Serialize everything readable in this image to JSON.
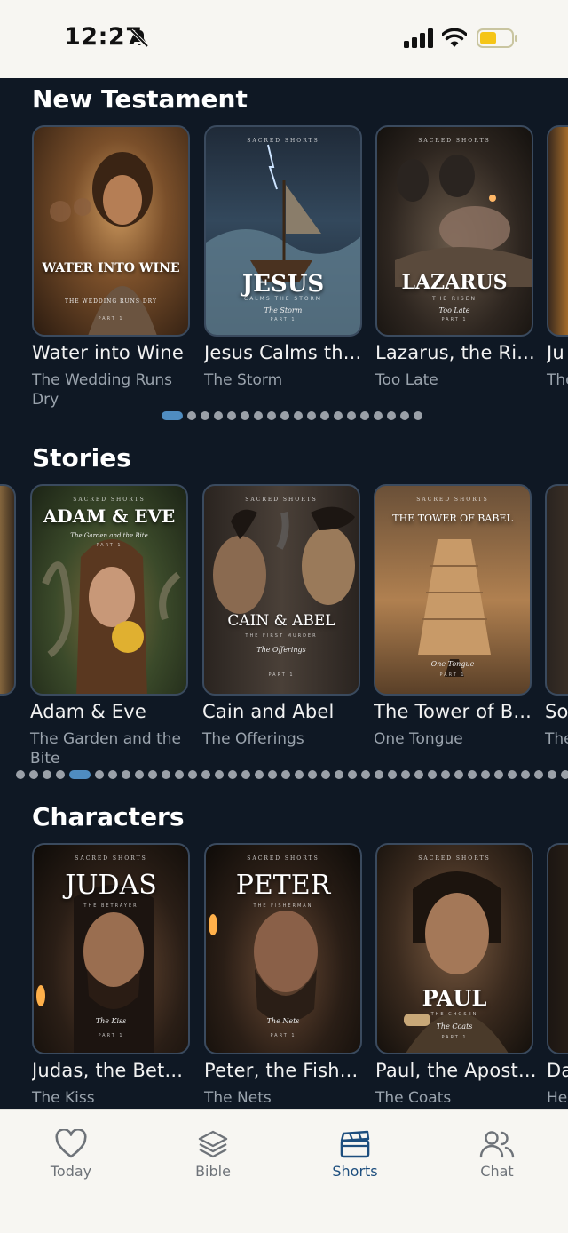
{
  "status_bar": {
    "time": "12:27"
  },
  "sections": [
    {
      "title": "New Testament",
      "cards": [
        {
          "title": "Water into Wine",
          "subtitle": "The Wedding Runs Dry",
          "poster_title": "WATER INTO WINE",
          "poster_sub": "THE WEDDING RUNS DRY",
          "poster_part": "PART 1"
        },
        {
          "title": "Jesus Calms th...",
          "subtitle": "The Storm",
          "poster_top": "SACRED SHORTS",
          "poster_title": "JESUS",
          "poster_tag": "CALMS THE STORM",
          "poster_sub": "The Storm",
          "poster_part": "PART 1"
        },
        {
          "title": "Lazarus, the Ri...",
          "subtitle": "Too Late",
          "poster_top": "SACRED SHORTS",
          "poster_title": "LAZARUS",
          "poster_tag": "THE RISEN",
          "poster_sub": "Too Late",
          "poster_part": "PART 1"
        },
        {
          "title": "Ju",
          "subtitle": "The"
        }
      ]
    },
    {
      "title": "Stories",
      "cards": [
        {
          "title": "Adam & Eve",
          "subtitle": "The Garden and the Bite",
          "poster_top": "SACRED SHORTS",
          "poster_title": "ADAM & EVE",
          "poster_sub": "The Garden and the Bite",
          "poster_part": "PART 1"
        },
        {
          "title": "Cain and Abel",
          "subtitle": "The Offerings",
          "poster_top": "SACRED SHORTS",
          "poster_title": "CAIN & ABEL",
          "poster_tag": "THE FIRST MURDER",
          "poster_sub": "The Offerings",
          "poster_part": "PART 1"
        },
        {
          "title": "The Tower of B...",
          "subtitle": "One Tongue",
          "poster_top": "SACRED SHORTS",
          "poster_title": "THE TOWER OF BABEL",
          "poster_sub": "One Tongue",
          "poster_part": "PART 1"
        },
        {
          "title": "So",
          "subtitle": "The Nig"
        }
      ]
    },
    {
      "title": "Characters",
      "cards": [
        {
          "title": "Judas, the Bet...",
          "subtitle": "The Kiss",
          "poster_top": "SACRED SHORTS",
          "poster_title": "JUDAS",
          "poster_tag": "THE BETRAYER",
          "poster_sub": "The Kiss",
          "poster_part": "PART 1"
        },
        {
          "title": "Peter, the Fish...",
          "subtitle": "The Nets",
          "poster_top": "SACRED SHORTS",
          "poster_title": "PETER",
          "poster_tag": "THE FISHERMAN",
          "poster_sub": "The Nets",
          "poster_part": "PART 1"
        },
        {
          "title": "Paul, the Apost...",
          "subtitle": "The Coats",
          "poster_top": "SACRED SHORTS",
          "poster_title": "PAUL",
          "poster_tag": "THE CHOSEN",
          "poster_sub": "The Coats",
          "poster_part": "PART 1"
        },
        {
          "title": "Da",
          "subtitle": "He"
        }
      ]
    }
  ],
  "pagination": {
    "new_testament": {
      "total": 19,
      "active": 1
    },
    "stories": {
      "total": 41,
      "active": 5
    }
  },
  "tabs": [
    {
      "label": "Today",
      "icon": "heart-icon",
      "active": false
    },
    {
      "label": "Bible",
      "icon": "layers-icon",
      "active": false
    },
    {
      "label": "Shorts",
      "icon": "clapperboard-icon",
      "active": true
    },
    {
      "label": "Chat",
      "icon": "users-icon",
      "active": false
    }
  ],
  "colors": {
    "background": "#0f1824",
    "accent": "#1d4e7e",
    "dot_active": "#4f8cc0",
    "battery": "#f5c518"
  }
}
